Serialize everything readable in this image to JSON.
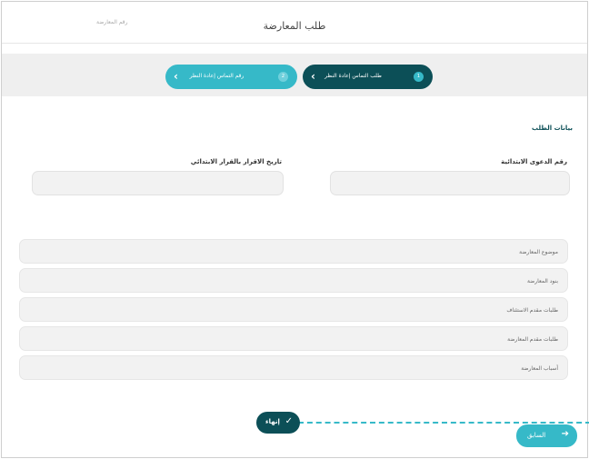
{
  "header": {
    "title": "طلب المعارضة",
    "reference_label": "رقم المعارضة"
  },
  "stepper": {
    "steps": [
      {
        "number": "1",
        "label": "طلب التماس إعادة النظر",
        "state": "active"
      },
      {
        "number": "2",
        "label": "رقم التماس إعادة النظر",
        "state": "upcoming"
      }
    ],
    "chevron_icon": "chevron-left-icon"
  },
  "form": {
    "section_title": "بيانات الطلب",
    "case_number_label": "رقم الدعوى الابتدائية",
    "case_number_value": "",
    "decision_date_label": "تاريخ الاقرار بالقرار الابتدائي",
    "decision_date_value": "",
    "rows": [
      {
        "label": "موضوع المعارضة"
      },
      {
        "label": "بنود المعارضة"
      },
      {
        "label": "طلبات مقدم الاستئناف"
      },
      {
        "label": "طلبات مقدم المعارضة"
      },
      {
        "label": "أسباب المعارضة"
      }
    ]
  },
  "actions": {
    "finish_label": "إنهاء",
    "finish_icon": "check-icon",
    "previous_label": "السابق",
    "previous_icon": "arrow-right-icon"
  },
  "colors": {
    "primary_dark": "#0c4f57",
    "accent": "#36b9c8",
    "field_bg": "#f2f2f2"
  }
}
